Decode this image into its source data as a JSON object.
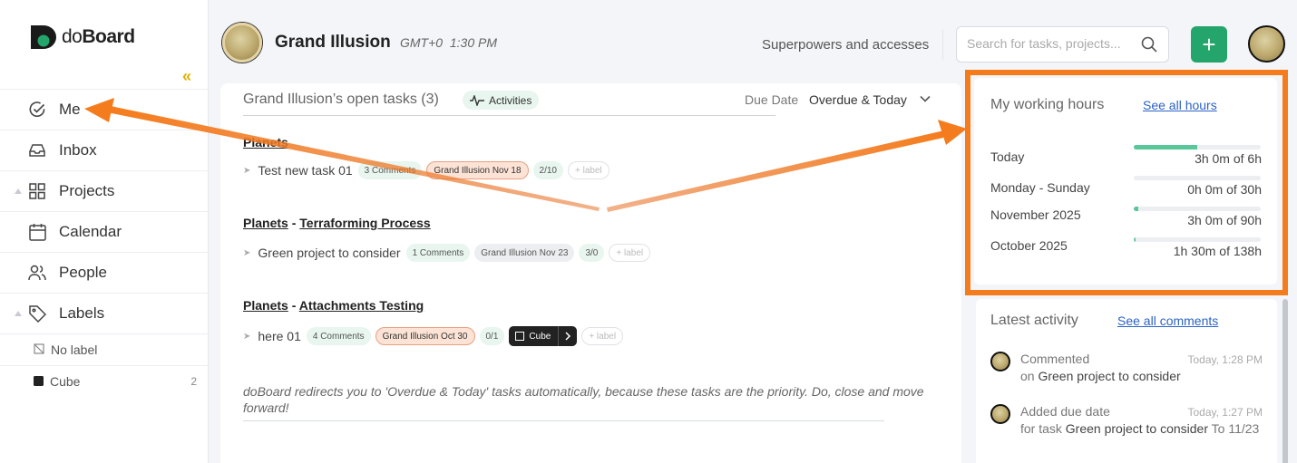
{
  "app": {
    "name_prefix": "do",
    "name_suffix": "Board"
  },
  "sidebar": {
    "collapse_glyph": "«",
    "items": [
      {
        "label": "Me",
        "icon": "check-circle-icon"
      },
      {
        "label": "Inbox",
        "icon": "inbox-icon"
      },
      {
        "label": "Projects",
        "icon": "grid-icon"
      },
      {
        "label": "Calendar",
        "icon": "calendar-icon"
      },
      {
        "label": "People",
        "icon": "people-icon"
      },
      {
        "label": "Labels",
        "icon": "tag-icon"
      }
    ],
    "labels": [
      {
        "label": "No label",
        "icon": "no-label-icon"
      },
      {
        "label": "Cube",
        "count": "2",
        "color": "#222222"
      }
    ]
  },
  "header": {
    "name": "Grand Illusion",
    "timezone": "GMT+0",
    "time": "1:30 PM",
    "superpowers": "Superpowers and accesses",
    "search_placeholder": "Search for tasks, projects...",
    "add_glyph": "+",
    "accent": "#23a56b"
  },
  "main": {
    "title": "Grand Illusion’s open tasks (3)",
    "activities": "Activities",
    "due_label": "Due Date",
    "due_value": "Overdue & Today",
    "groups": [
      {
        "project": "Planets",
        "section": "",
        "task": {
          "name": "Test new task 01",
          "comments": "3 Comments",
          "due": "Grand Illusion Nov 18",
          "progress": "2/10",
          "label": "+ label"
        }
      },
      {
        "project": "Planets",
        "separator": "-",
        "section": "Terraforming Process",
        "task": {
          "name": "Green project to consider",
          "comments": "1 Comments",
          "due": "Grand Illusion Nov 23",
          "progress": "3/0",
          "label": "+ label"
        }
      },
      {
        "project": "Planets",
        "separator": "-",
        "section": "Attachments Testing",
        "task": {
          "name": "here 01",
          "comments": "4 Comments",
          "due": "Grand Illusion Oct 30",
          "progress": "0/1",
          "tag": "Cube",
          "label": "+ label"
        }
      }
    ],
    "note": "doBoard redirects you to 'Overdue & Today' tasks automatically, because these tasks are the priority. Do, close and move forward!"
  },
  "working_hours": {
    "title": "My working hours",
    "link": "See all hours",
    "rows": [
      {
        "label": "Today",
        "value": "3h 0m of 6h",
        "fraction": 0.5
      },
      {
        "label": "Monday - Sunday",
        "value": "0h 0m of 30h",
        "fraction": 0
      },
      {
        "label": "November 2025",
        "value": "3h 0m of 90h",
        "fraction": 0.033
      },
      {
        "label": "October 2025",
        "value": "1h 30m of 138h",
        "fraction": 0.011
      }
    ],
    "highlight_color": "#f57c1c"
  },
  "latest_activity": {
    "title": "Latest activity",
    "link": "See all comments",
    "items": [
      {
        "action": "Commented",
        "time": "Today, 1:28 PM",
        "prefix": "on",
        "target": "Green project to consider",
        "suffix": ""
      },
      {
        "action": "Added due date",
        "time": "Today, 1:27 PM",
        "prefix": "for task",
        "target": "Green project to consider",
        "suffix": "To 11/23"
      }
    ]
  }
}
